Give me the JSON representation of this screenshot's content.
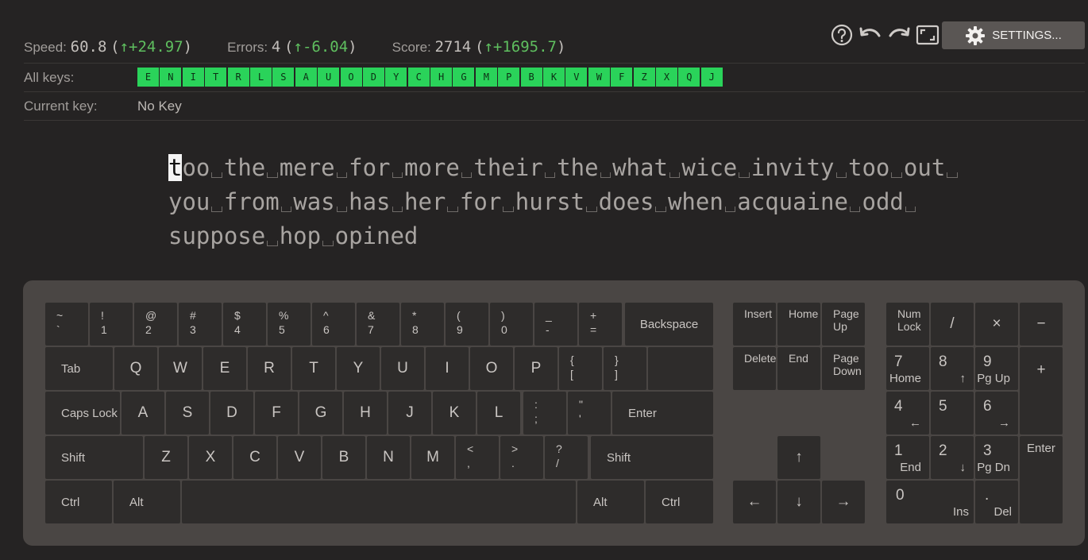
{
  "stats": {
    "speed": {
      "label": "Speed:",
      "value": "60.8",
      "delta": "+24.97"
    },
    "errors": {
      "label": "Errors:",
      "value": "4",
      "delta": "-6.04"
    },
    "score": {
      "label": "Score:",
      "value": "2714",
      "delta": "+1695.7"
    }
  },
  "all_keys_label": "All keys:",
  "all_keys": [
    "E",
    "N",
    "I",
    "T",
    "R",
    "L",
    "S",
    "A",
    "U",
    "O",
    "D",
    "Y",
    "C",
    "H",
    "G",
    "M",
    "P",
    "B",
    "K",
    "V",
    "W",
    "F",
    "Z",
    "X",
    "Q",
    "J"
  ],
  "current_key_label": "Current key:",
  "current_key_value": "No Key",
  "toolbar": {
    "settings_label": "SETTINGS..."
  },
  "text_lines": [
    [
      "too",
      "the",
      "mere",
      "for",
      "more",
      "their",
      "the",
      "what",
      "wice",
      "invity",
      "too",
      "out"
    ],
    [
      "you",
      "from",
      "was",
      "has",
      "her",
      "for",
      "hurst",
      "does",
      "when",
      "acquaine",
      "odd"
    ],
    [
      "suppose",
      "hop",
      "opined"
    ]
  ],
  "keyboard": {
    "row1": [
      [
        "~",
        "`"
      ],
      [
        "!",
        "1"
      ],
      [
        "@",
        "2"
      ],
      [
        "#",
        "3"
      ],
      [
        "$",
        "4"
      ],
      [
        "%",
        "5"
      ],
      [
        "^",
        "6"
      ],
      [
        "&",
        "7"
      ],
      [
        "*",
        "8"
      ],
      [
        "(",
        "9"
      ],
      [
        ")",
        "0"
      ],
      [
        "_",
        "-"
      ],
      [
        "+",
        "="
      ]
    ],
    "backspace": "Backspace",
    "tab": "Tab",
    "row2": [
      "Q",
      "W",
      "E",
      "R",
      "T",
      "Y",
      "U",
      "I",
      "O",
      "P"
    ],
    "row2_sym": [
      [
        "{",
        "["
      ],
      [
        "}",
        "]"
      ],
      [
        "|",
        "\\"
      ]
    ],
    "caps": "Caps Lock",
    "row3": [
      "A",
      "S",
      "D",
      "F",
      "G",
      "H",
      "J",
      "K",
      "L"
    ],
    "row3_sym": [
      [
        ":",
        ";"
      ],
      [
        "\"",
        "'"
      ]
    ],
    "enter": "Enter",
    "shift": "Shift",
    "row4": [
      "Z",
      "X",
      "C",
      "V",
      "B",
      "N",
      "M"
    ],
    "row4_sym": [
      [
        "<",
        ","
      ],
      [
        ">",
        "."
      ],
      [
        "?",
        "/"
      ]
    ],
    "ctrl": "Ctrl",
    "alt": "Alt",
    "nav": {
      "insert": "Insert",
      "home": "Home",
      "pageup": "Page\nUp",
      "delete": "Delete",
      "end": "End",
      "pagedown": "Page\nDown"
    },
    "arrows": {
      "up": "↑",
      "left": "←",
      "down": "↓",
      "right": "→"
    },
    "numpad": {
      "numlock": "Num\nLock",
      "divide": "/",
      "multiply": "×",
      "minus": "−",
      "plus": "+",
      "enter": "Enter",
      "n7": [
        "7",
        "Home"
      ],
      "n8": [
        "8",
        "↑"
      ],
      "n9": [
        "9",
        "Pg Up"
      ],
      "n4": [
        "4",
        "←"
      ],
      "n5": [
        "5",
        ""
      ],
      "n6": [
        "6",
        "→"
      ],
      "n1": [
        "1",
        "End"
      ],
      "n2": [
        "2",
        "↓"
      ],
      "n3": [
        "3",
        "Pg Dn"
      ],
      "n0": [
        "0",
        "Ins"
      ],
      "ndot": [
        ".",
        "Del"
      ]
    }
  },
  "colors": {
    "background": "#252323",
    "key_ok": "#2ad35a",
    "delta_up": "#5fbf5f",
    "keyboard_body": "#4a4644",
    "key": "#2e2c2b"
  }
}
